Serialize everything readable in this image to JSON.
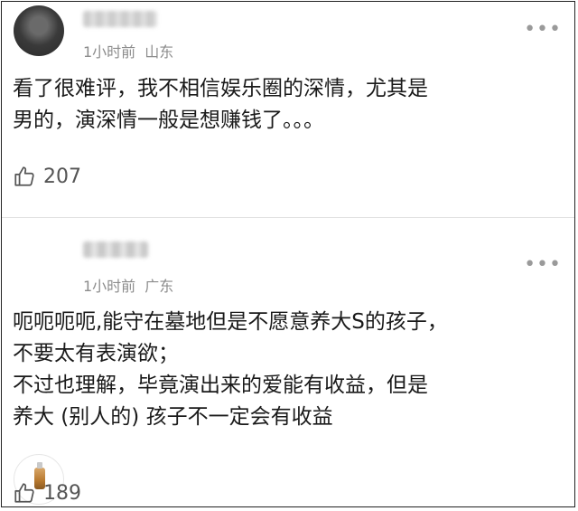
{
  "comments": [
    {
      "time": "1小时前",
      "location": "山东",
      "more_icon": "more-dots-icon",
      "lines": [
        "看了很难评，我不相信娱乐圈的深情，尤其是",
        "男的，演深情一般是想赚钱了。。。"
      ],
      "likes": "207",
      "like_icon": "thumbs-up-icon"
    },
    {
      "time": "1小时前",
      "location": "广东",
      "more_icon": "more-dots-icon",
      "lines": [
        "呃呃呃呃,能守在墓地但是不愿意养大S的孩子，",
        "不要太有表演欲；",
        "不过也理解，毕竟演出来的爱能有收益，但是",
        "养大 (别人的) 孩子不一定会有收益"
      ],
      "likes": "189",
      "like_icon": "thumbs-up-icon"
    }
  ]
}
